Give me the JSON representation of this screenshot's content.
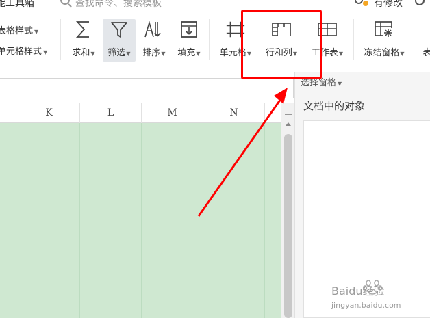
{
  "topbar": {
    "smart_toolbox": "能工具箱",
    "search_placeholder": "查找命令、搜索模板",
    "changed_label": "有修改"
  },
  "ribbon": {
    "table_style": "表格样式",
    "cell_style": "单元格样式",
    "buttons": [
      {
        "label": "求和",
        "icon": "sum-icon",
        "has_caret": true
      },
      {
        "label": "筛选",
        "icon": "filter-icon",
        "has_caret": true,
        "active": true
      },
      {
        "label": "排序",
        "icon": "sort-icon",
        "has_caret": true
      },
      {
        "label": "填充",
        "icon": "fill-icon",
        "has_caret": true
      },
      {
        "label": "单元格",
        "icon": "cell-icon",
        "has_caret": true
      },
      {
        "label": "行和列",
        "icon": "rows-columns-icon",
        "has_caret": true
      },
      {
        "label": "工作表",
        "icon": "worksheet-icon",
        "has_caret": true
      },
      {
        "label": "冻结窗格",
        "icon": "freeze-panes-icon",
        "has_caret": true
      },
      {
        "label": "表",
        "icon": "",
        "has_caret": false
      }
    ]
  },
  "sheet": {
    "columns": [
      "K",
      "L",
      "M",
      "N"
    ]
  },
  "pane": {
    "dropdown": "选择窗格",
    "title": "文档中的对象"
  },
  "watermark": {
    "brand": "Baidu经验",
    "url": "jingyan.baidu.com"
  },
  "annotation": {
    "highlight_color": "#ff0000"
  }
}
